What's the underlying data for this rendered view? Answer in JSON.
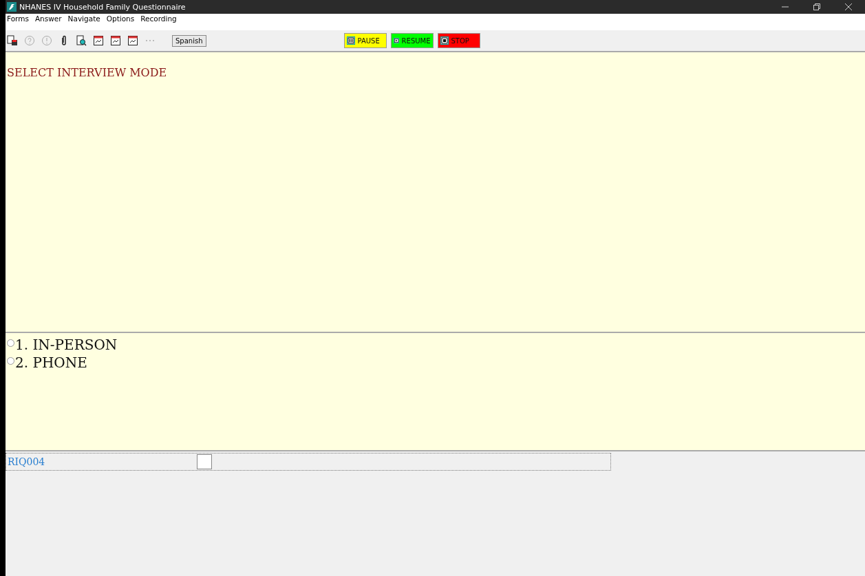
{
  "window": {
    "title": "NHANES IV Household Family Questionnaire"
  },
  "menu": [
    "Forms",
    "Answer",
    "Navigate",
    "Options",
    "Recording"
  ],
  "toolbar": {
    "icons": [
      {
        "kind": "save",
        "disabled": false
      },
      {
        "kind": "help",
        "disabled": true
      },
      {
        "kind": "alert",
        "disabled": true
      },
      {
        "kind": "clip",
        "disabled": false
      },
      {
        "kind": "preview",
        "disabled": false
      },
      {
        "kind": "form",
        "disabled": false
      },
      {
        "kind": "form",
        "disabled": false
      },
      {
        "kind": "form",
        "disabled": false
      },
      {
        "kind": "more",
        "disabled": true
      }
    ],
    "language_button": "Spanish",
    "recording_buttons": [
      {
        "kind": "pause",
        "label": "PAUSE",
        "color": "#ffff00"
      },
      {
        "kind": "resume",
        "label": "RESUME",
        "color": "#00ff00"
      },
      {
        "kind": "stop",
        "label": "STOP",
        "color": "#ff0000"
      }
    ]
  },
  "question": {
    "text": "SELECT INTERVIEW MODE"
  },
  "answers": [
    {
      "label": "1. IN-PERSON",
      "selected": false
    },
    {
      "label": "2. PHONE",
      "selected": false
    }
  ],
  "field": {
    "name": "RIQ004"
  }
}
